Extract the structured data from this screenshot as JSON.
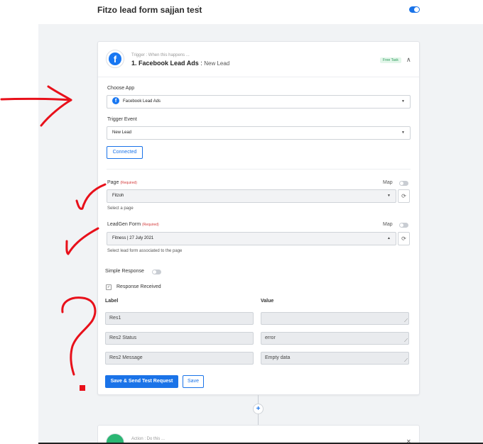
{
  "header": {
    "title": "Fitzo lead form sajjan test",
    "kebab": "⋮",
    "toggle_on": true,
    "accent": "#1a73e8"
  },
  "trigger": {
    "subtitle": "Trigger : When this happens ...",
    "title": "1. Facebook Lead Ads",
    "event_label": "New Lead",
    "badge": "Free Task",
    "collapse_icon": "chevron-up-icon"
  },
  "form": {
    "choose_app_label": "Choose App",
    "choose_app_value": "Facebook Lead Ads",
    "trigger_event_label": "Trigger Event",
    "trigger_event_value": "New Lead",
    "connected_label": "Connected",
    "page_label": "Page",
    "page_required": "(Required)",
    "page_map_label": "Map",
    "page_value": "Fitzoh",
    "page_help": "Select a page",
    "leadgen_label": "LeadGen Form",
    "leadgen_required": "(Required)",
    "leadgen_map_label": "Map",
    "leadgen_value": "Fitness | 27 July 2021",
    "leadgen_help": "Select lead form associated to the page",
    "simple_response_label": "Simple Response",
    "response_received_label": "Response Received",
    "col_label": "Label",
    "col_value": "Value",
    "rows": [
      {
        "label": "Res1",
        "value": ""
      },
      {
        "label": "Res2 Status",
        "value": "error"
      },
      {
        "label": "Res2 Message",
        "value": "Empty data"
      }
    ],
    "save_send_label": "Save & Send Test Request",
    "save_label": "Save"
  },
  "action": {
    "subtitle": "Action : Do this ..."
  },
  "annotations": {
    "ink_color": "#e8101a"
  }
}
